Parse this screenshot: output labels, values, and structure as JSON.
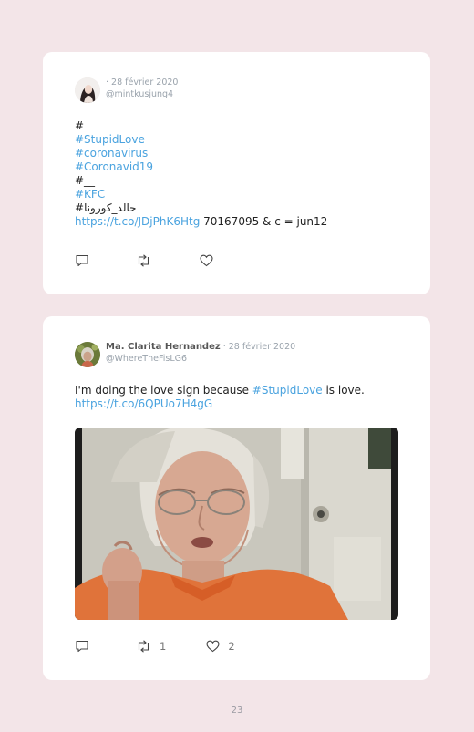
{
  "page_number": "23",
  "tweets": [
    {
      "display_name": "",
      "date": "28 février 2020",
      "handle": "@mintkusjung4",
      "lines": [
        [
          {
            "t": "#",
            "link": false
          }
        ],
        [
          {
            "t": "#StupidLove",
            "link": true
          }
        ],
        [
          {
            "t": "#coronavirus",
            "link": true
          }
        ],
        [
          {
            "t": "#Coronavid19",
            "link": true
          }
        ],
        [
          {
            "t": "#__",
            "link": false
          }
        ],
        [
          {
            "t": "#KFC",
            "link": true
          }
        ],
        [
          {
            "t": "#حالد_كورونا",
            "link": false
          }
        ],
        [
          {
            "t": "https://t.co/JDjPhK6Htg",
            "link": true
          },
          {
            "t": " 70167095 & c = jun12",
            "link": false
          }
        ]
      ],
      "retweets": "",
      "likes": ""
    },
    {
      "display_name": "Ma. Clarita Hernandez",
      "date": "28 février 2020",
      "handle": "@WhereTheFisLG6",
      "lines": [
        [
          {
            "t": "I'm doing the love sign because ",
            "link": false
          },
          {
            "t": "#StupidLove",
            "link": true
          },
          {
            "t": " is love.",
            "link": false
          }
        ],
        [
          {
            "t": "https://t.co/6QPUo7H4gG",
            "link": true
          }
        ]
      ],
      "retweets": "1",
      "likes": "2"
    }
  ],
  "colors": {
    "link": "#4aa3df",
    "page_bg": "#f3e5e8",
    "card_bg": "#ffffff"
  },
  "icons": [
    "reply-icon",
    "retweet-icon",
    "like-icon"
  ]
}
